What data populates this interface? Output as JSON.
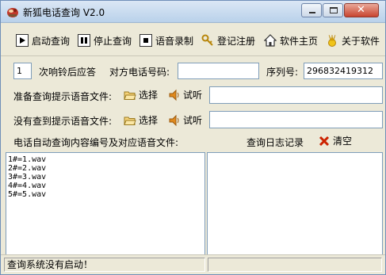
{
  "window": {
    "title": "新狐电话查询 V2.0"
  },
  "toolbar": {
    "items": [
      {
        "label": "启动查询",
        "icon": "play-icon"
      },
      {
        "label": "停止查询",
        "icon": "pause-icon"
      },
      {
        "label": "语音录制",
        "icon": "record-icon"
      },
      {
        "label": "登记注册",
        "icon": "key-icon"
      },
      {
        "label": "软件主页",
        "icon": "home-icon"
      },
      {
        "label": "关于软件",
        "icon": "about-icon"
      }
    ]
  },
  "settings": {
    "rings_value": "1",
    "rings_label": "次响铃后应答",
    "caller_label": "对方电话号码:",
    "caller_value": "",
    "serial_label": "序列号:",
    "serial_value": "296832419312"
  },
  "prompt_files": {
    "query_label": "准备查询提示语音文件:",
    "query_path": "",
    "notfound_label": "没有查到提示语音文件:",
    "notfound_path": "",
    "select_label": "选择",
    "listen_label": "试听"
  },
  "section": {
    "list_label": "电话自动查询内容编号及对应语音文件:",
    "log_label": "查询日志记录",
    "clear_label": "清空"
  },
  "voice_list": [
    "1#=1.wav",
    "2#=2.wav",
    "3#=3.wav",
    "4#=4.wav",
    "5#=5.wav"
  ],
  "status": {
    "message": "查询系统没有启动！",
    "right": ""
  },
  "colors": {
    "accent_red": "#cc2200",
    "icon_orange": "#e08a1e",
    "field_border": "#7f9db9"
  }
}
